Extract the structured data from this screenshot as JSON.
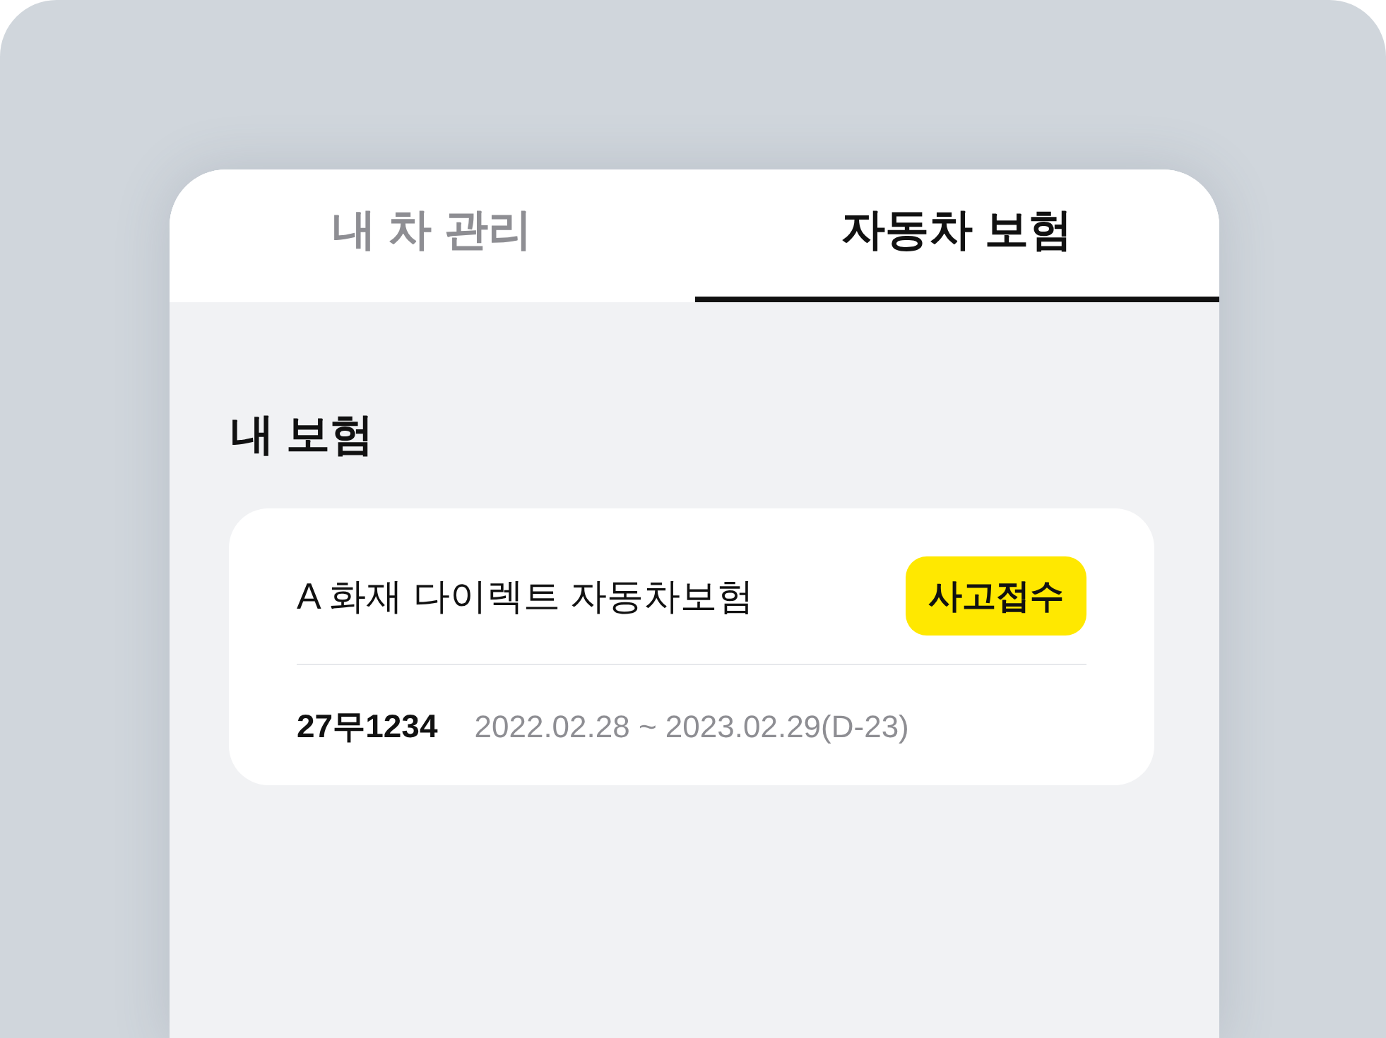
{
  "tabs": [
    {
      "label": "내 차 관리",
      "selected": false
    },
    {
      "label": "자동차 보험",
      "selected": true
    }
  ],
  "section": {
    "title": "내 보험"
  },
  "insurance_cards": [
    {
      "name": "A 화재 다이렉트 자동차보험",
      "action": "사고접수",
      "plate": "27무1234",
      "period": "2022.02.28 ~ 2023.02.29(D-23)"
    }
  ]
}
